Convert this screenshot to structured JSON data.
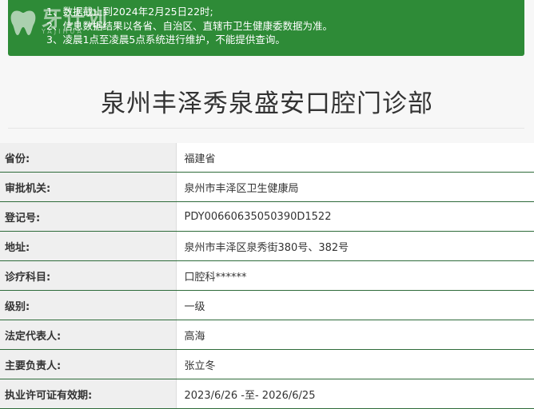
{
  "notice": {
    "lines": [
      "1、数据截止到2024年2月25日22时;",
      "2、信息数据结果以各省、自治区、直辖市卫生健康委数据为准。",
      "3、凌晨1点至凌晨5点系统进行维护，不能提供查询。"
    ]
  },
  "logo": {
    "brand": "牙计划",
    "sub": "YAJIHUA",
    "icon": "tooth-icon"
  },
  "page": {
    "title": "泉州丰泽秀泉盛安口腔门诊部"
  },
  "info": {
    "rows": [
      {
        "label": "省份:",
        "value": "福建省"
      },
      {
        "label": "审批机关:",
        "value": "泉州市丰泽区卫生健康局"
      },
      {
        "label": "登记号:",
        "value": "PDY00660635050390D1522"
      },
      {
        "label": "地址:",
        "value": "泉州市丰泽区泉秀街380号、382号"
      },
      {
        "label": "诊疗科目:",
        "value": "口腔科******"
      },
      {
        "label": "级别:",
        "value": "一级"
      },
      {
        "label": "法定代表人:",
        "value": "高海"
      },
      {
        "label": "主要负责人:",
        "value": "张立冬"
      },
      {
        "label": "执业许可证有效期:",
        "value": "2023/6/26 -至- 2026/6/25"
      }
    ]
  },
  "colors": {
    "notice_bg": "#2e8b37",
    "row_border": "#2e6b3a",
    "label_bg": "#efefef"
  }
}
